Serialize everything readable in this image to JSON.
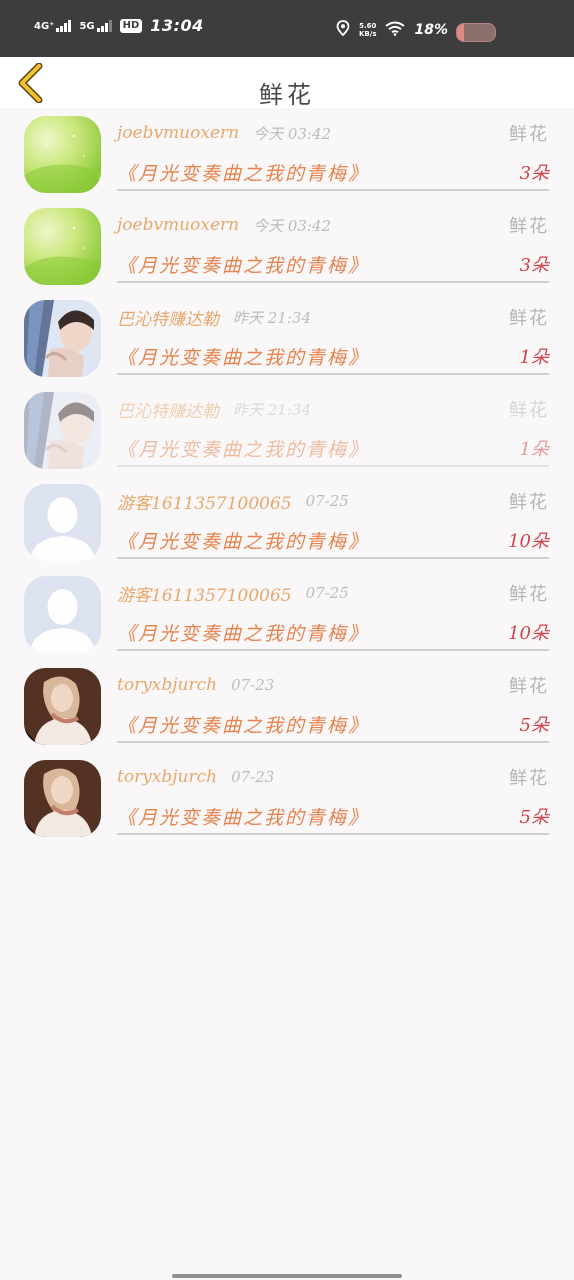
{
  "status_bar": {
    "net1": "4G⁺",
    "net2": "5G",
    "hd": "HD",
    "time": "13:04",
    "speed_value": "5.60",
    "speed_unit": "KB/s",
    "battery_text": "18%",
    "battery_level": 0.18,
    "icons": [
      "signal-icon",
      "signal-icon",
      "hd-icon",
      "location-icon",
      "wifi-icon",
      "battery-icon"
    ]
  },
  "header": {
    "title": "鲜花",
    "back_icon": "chevron-left-icon"
  },
  "items": [
    {
      "user": "joebvmuoxern",
      "time": "今天 03:42",
      "gift": "鲜花",
      "book": "《月光变奏曲之我的青梅》",
      "count": "3朵",
      "avatar": "green"
    },
    {
      "user": "joebvmuoxern",
      "time": "今天 03:42",
      "gift": "鲜花",
      "book": "《月光变奏曲之我的青梅》",
      "count": "3朵",
      "avatar": "green"
    },
    {
      "user": "巴沁特赚达勒",
      "time": "昨天 21:34",
      "gift": "鲜花",
      "book": "《月光变奏曲之我的青梅》",
      "count": "1朵",
      "avatar": "portrait-male"
    },
    {
      "user": "巴沁特赚达勒",
      "time": "昨天 21:34",
      "gift": "鲜花",
      "book": "《月光变奏曲之我的青梅》",
      "count": "1朵",
      "avatar": "portrait-male"
    },
    {
      "user": "游客1611357100065",
      "time": "07-25",
      "gift": "鲜花",
      "book": "《月光变奏曲之我的青梅》",
      "count": "10朵",
      "avatar": "default"
    },
    {
      "user": "游客1611357100065",
      "time": "07-25",
      "gift": "鲜花",
      "book": "《月光变奏曲之我的青梅》",
      "count": "10朵",
      "avatar": "default"
    },
    {
      "user": "toryxbjurch",
      "time": "07-23",
      "gift": "鲜花",
      "book": "《月光变奏曲之我的青梅》",
      "count": "5朵",
      "avatar": "portrait-female"
    },
    {
      "user": "toryxbjurch",
      "time": "07-23",
      "gift": "鲜花",
      "book": "《月光变奏曲之我的青梅》",
      "count": "5朵",
      "avatar": "portrait-female"
    }
  ],
  "colors": {
    "username": "#e8a76b",
    "book": "#e6834e",
    "count": "#d1434c",
    "muted": "#bcbcbc",
    "background": "#f9f7f8"
  }
}
